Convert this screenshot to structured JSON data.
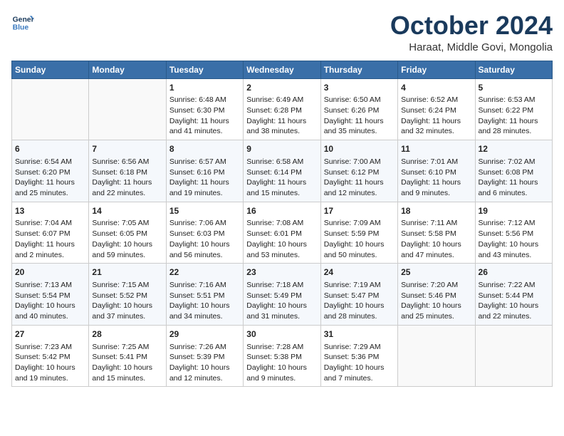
{
  "header": {
    "logo_line1": "General",
    "logo_line2": "Blue",
    "month_title": "October 2024",
    "location": "Haraat, Middle Govi, Mongolia"
  },
  "weekdays": [
    "Sunday",
    "Monday",
    "Tuesday",
    "Wednesday",
    "Thursday",
    "Friday",
    "Saturday"
  ],
  "weeks": [
    [
      {
        "day": "",
        "sunrise": "",
        "sunset": "",
        "daylight": ""
      },
      {
        "day": "",
        "sunrise": "",
        "sunset": "",
        "daylight": ""
      },
      {
        "day": "1",
        "sunrise": "Sunrise: 6:48 AM",
        "sunset": "Sunset: 6:30 PM",
        "daylight": "Daylight: 11 hours and 41 minutes."
      },
      {
        "day": "2",
        "sunrise": "Sunrise: 6:49 AM",
        "sunset": "Sunset: 6:28 PM",
        "daylight": "Daylight: 11 hours and 38 minutes."
      },
      {
        "day": "3",
        "sunrise": "Sunrise: 6:50 AM",
        "sunset": "Sunset: 6:26 PM",
        "daylight": "Daylight: 11 hours and 35 minutes."
      },
      {
        "day": "4",
        "sunrise": "Sunrise: 6:52 AM",
        "sunset": "Sunset: 6:24 PM",
        "daylight": "Daylight: 11 hours and 32 minutes."
      },
      {
        "day": "5",
        "sunrise": "Sunrise: 6:53 AM",
        "sunset": "Sunset: 6:22 PM",
        "daylight": "Daylight: 11 hours and 28 minutes."
      }
    ],
    [
      {
        "day": "6",
        "sunrise": "Sunrise: 6:54 AM",
        "sunset": "Sunset: 6:20 PM",
        "daylight": "Daylight: 11 hours and 25 minutes."
      },
      {
        "day": "7",
        "sunrise": "Sunrise: 6:56 AM",
        "sunset": "Sunset: 6:18 PM",
        "daylight": "Daylight: 11 hours and 22 minutes."
      },
      {
        "day": "8",
        "sunrise": "Sunrise: 6:57 AM",
        "sunset": "Sunset: 6:16 PM",
        "daylight": "Daylight: 11 hours and 19 minutes."
      },
      {
        "day": "9",
        "sunrise": "Sunrise: 6:58 AM",
        "sunset": "Sunset: 6:14 PM",
        "daylight": "Daylight: 11 hours and 15 minutes."
      },
      {
        "day": "10",
        "sunrise": "Sunrise: 7:00 AM",
        "sunset": "Sunset: 6:12 PM",
        "daylight": "Daylight: 11 hours and 12 minutes."
      },
      {
        "day": "11",
        "sunrise": "Sunrise: 7:01 AM",
        "sunset": "Sunset: 6:10 PM",
        "daylight": "Daylight: 11 hours and 9 minutes."
      },
      {
        "day": "12",
        "sunrise": "Sunrise: 7:02 AM",
        "sunset": "Sunset: 6:08 PM",
        "daylight": "Daylight: 11 hours and 6 minutes."
      }
    ],
    [
      {
        "day": "13",
        "sunrise": "Sunrise: 7:04 AM",
        "sunset": "Sunset: 6:07 PM",
        "daylight": "Daylight: 11 hours and 2 minutes."
      },
      {
        "day": "14",
        "sunrise": "Sunrise: 7:05 AM",
        "sunset": "Sunset: 6:05 PM",
        "daylight": "Daylight: 10 hours and 59 minutes."
      },
      {
        "day": "15",
        "sunrise": "Sunrise: 7:06 AM",
        "sunset": "Sunset: 6:03 PM",
        "daylight": "Daylight: 10 hours and 56 minutes."
      },
      {
        "day": "16",
        "sunrise": "Sunrise: 7:08 AM",
        "sunset": "Sunset: 6:01 PM",
        "daylight": "Daylight: 10 hours and 53 minutes."
      },
      {
        "day": "17",
        "sunrise": "Sunrise: 7:09 AM",
        "sunset": "Sunset: 5:59 PM",
        "daylight": "Daylight: 10 hours and 50 minutes."
      },
      {
        "day": "18",
        "sunrise": "Sunrise: 7:11 AM",
        "sunset": "Sunset: 5:58 PM",
        "daylight": "Daylight: 10 hours and 47 minutes."
      },
      {
        "day": "19",
        "sunrise": "Sunrise: 7:12 AM",
        "sunset": "Sunset: 5:56 PM",
        "daylight": "Daylight: 10 hours and 43 minutes."
      }
    ],
    [
      {
        "day": "20",
        "sunrise": "Sunrise: 7:13 AM",
        "sunset": "Sunset: 5:54 PM",
        "daylight": "Daylight: 10 hours and 40 minutes."
      },
      {
        "day": "21",
        "sunrise": "Sunrise: 7:15 AM",
        "sunset": "Sunset: 5:52 PM",
        "daylight": "Daylight: 10 hours and 37 minutes."
      },
      {
        "day": "22",
        "sunrise": "Sunrise: 7:16 AM",
        "sunset": "Sunset: 5:51 PM",
        "daylight": "Daylight: 10 hours and 34 minutes."
      },
      {
        "day": "23",
        "sunrise": "Sunrise: 7:18 AM",
        "sunset": "Sunset: 5:49 PM",
        "daylight": "Daylight: 10 hours and 31 minutes."
      },
      {
        "day": "24",
        "sunrise": "Sunrise: 7:19 AM",
        "sunset": "Sunset: 5:47 PM",
        "daylight": "Daylight: 10 hours and 28 minutes."
      },
      {
        "day": "25",
        "sunrise": "Sunrise: 7:20 AM",
        "sunset": "Sunset: 5:46 PM",
        "daylight": "Daylight: 10 hours and 25 minutes."
      },
      {
        "day": "26",
        "sunrise": "Sunrise: 7:22 AM",
        "sunset": "Sunset: 5:44 PM",
        "daylight": "Daylight: 10 hours and 22 minutes."
      }
    ],
    [
      {
        "day": "27",
        "sunrise": "Sunrise: 7:23 AM",
        "sunset": "Sunset: 5:42 PM",
        "daylight": "Daylight: 10 hours and 19 minutes."
      },
      {
        "day": "28",
        "sunrise": "Sunrise: 7:25 AM",
        "sunset": "Sunset: 5:41 PM",
        "daylight": "Daylight: 10 hours and 15 minutes."
      },
      {
        "day": "29",
        "sunrise": "Sunrise: 7:26 AM",
        "sunset": "Sunset: 5:39 PM",
        "daylight": "Daylight: 10 hours and 12 minutes."
      },
      {
        "day": "30",
        "sunrise": "Sunrise: 7:28 AM",
        "sunset": "Sunset: 5:38 PM",
        "daylight": "Daylight: 10 hours and 9 minutes."
      },
      {
        "day": "31",
        "sunrise": "Sunrise: 7:29 AM",
        "sunset": "Sunset: 5:36 PM",
        "daylight": "Daylight: 10 hours and 7 minutes."
      },
      {
        "day": "",
        "sunrise": "",
        "sunset": "",
        "daylight": ""
      },
      {
        "day": "",
        "sunrise": "",
        "sunset": "",
        "daylight": ""
      }
    ]
  ]
}
